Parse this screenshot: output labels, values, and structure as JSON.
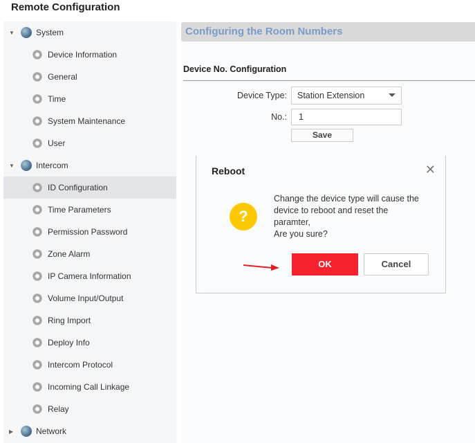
{
  "window_title": "Remote Configuration",
  "sidebar": {
    "groups": [
      {
        "label": "System",
        "expanded": true,
        "items": [
          "Device Information",
          "General",
          "Time",
          "System Maintenance",
          "User"
        ]
      },
      {
        "label": "Intercom",
        "expanded": true,
        "items": [
          "ID Configuration",
          "Time Parameters",
          "Permission Password",
          "Zone Alarm",
          "IP Camera Information",
          "Volume Input/Output",
          "Ring Import",
          "Deploy Info",
          "Intercom Protocol",
          "Incoming Call Linkage",
          "Relay"
        ]
      },
      {
        "label": "Network",
        "expanded": false,
        "items": []
      }
    ],
    "selected": "ID Configuration"
  },
  "header": {
    "title": "Configuring the Room Numbers"
  },
  "form": {
    "section": "Device No. Configuration",
    "device_type_label": "Device Type:",
    "device_type_value": "Station Extension",
    "no_label": "No.:",
    "no_value": "1",
    "save_label": "Save"
  },
  "dialog": {
    "title": "Reboot",
    "icon": "question-icon",
    "lines": [
      "Change the device type will cause the",
      "device to reboot and reset the",
      "paramter,",
      "Are you sure?"
    ],
    "ok_label": "OK",
    "cancel_label": "Cancel",
    "ok_color": "#f5222d"
  }
}
